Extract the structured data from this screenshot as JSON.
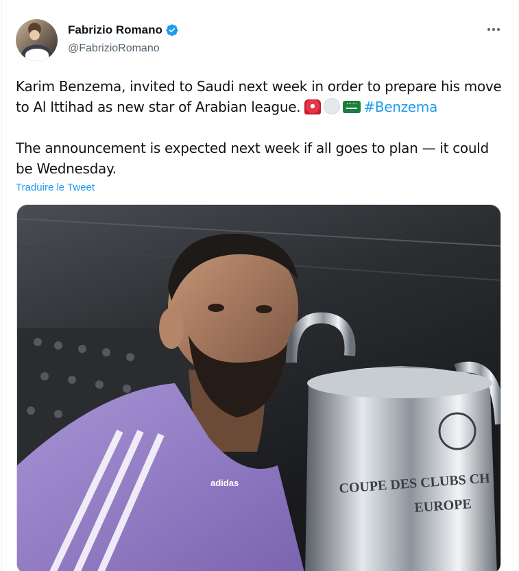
{
  "author": {
    "display_name": "Fabrizio Romano",
    "handle": "@FabrizioRomano",
    "verified": true
  },
  "tweet": {
    "paragraph1": "Karim Benzema, invited to Saudi next week in order to prepare his move to Al Ittihad as new star of Arabian league.",
    "emojis": [
      "rotating-light-icon",
      "white-circle-icon",
      "saudi-flag-icon"
    ],
    "hashtag": "#Benzema",
    "paragraph2": "The announcement is expected next week if all goes to plan — it could be Wednesday."
  },
  "translate_link": "Traduire le Tweet",
  "media": {
    "description_icon": "photo",
    "trophy_text_line1": "COUPE DES CLUBS CH",
    "trophy_text_line2": "EUROPE",
    "jacket_brand": "adidas"
  },
  "colors": {
    "link": "#1d9bf0",
    "secondary_text": "#536471",
    "jacket": "#9b84c9"
  }
}
